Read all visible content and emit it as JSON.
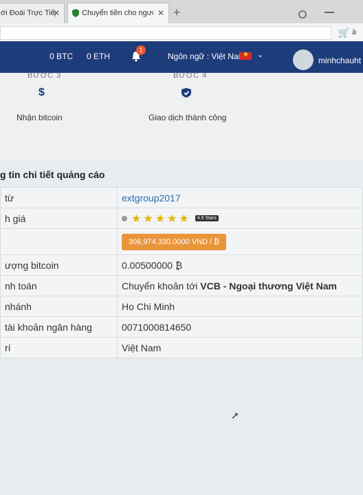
{
  "browser": {
    "tabs": [
      {
        "title": "ới Đoái Trực Tiếp",
        "active": false
      },
      {
        "title": "Chuyển tiền cho người hư",
        "active": true
      }
    ],
    "close_glyph": "✕",
    "new_tab_glyph": "+",
    "right_letter": "à"
  },
  "header": {
    "btc": "0 BTC",
    "eth": "0 ETH",
    "notification_count": "1",
    "language": "Ngôn ngữ : Việt Nam",
    "username": "minhchauht"
  },
  "steps": [
    {
      "label": "BƯỚC 3",
      "icon": "$",
      "icon_name": "dollar-icon",
      "text": "Nhận bitcoin"
    },
    {
      "label": "BƯỚC 4",
      "icon": "✔",
      "icon_name": "check-shield-icon",
      "text": "Giao dịch thành công"
    }
  ],
  "detail": {
    "title": "g tin chi tiết quảng cáo",
    "rows": {
      "from_label": "từ",
      "from_value": "extgroup2017",
      "rating_label": "h giá",
      "rating_stars": 5,
      "rating_badge": "4.9 Stars",
      "price_label": "",
      "price_value": "306,974,330.0000 VND / ₿",
      "amount_label": "ượng bitcoin",
      "amount_value": "0.00500000 ₿",
      "payment_label": "nh toán",
      "payment_prefix": "Chuyển khoản tới ",
      "payment_bank": "VCB - Ngoại thương Việt Nam",
      "branch_label": "nhánh",
      "branch_value": "Ho Chi Minh",
      "account_label": "tài khoản ngân hàng",
      "account_value": "0071000814650",
      "location_label": "rí",
      "location_value": "Việt Nam"
    }
  },
  "colors": {
    "header_bg": "#1d3c7a",
    "price_button": "#e9953a",
    "star": "#e2b400",
    "link": "#2a6bb3"
  }
}
